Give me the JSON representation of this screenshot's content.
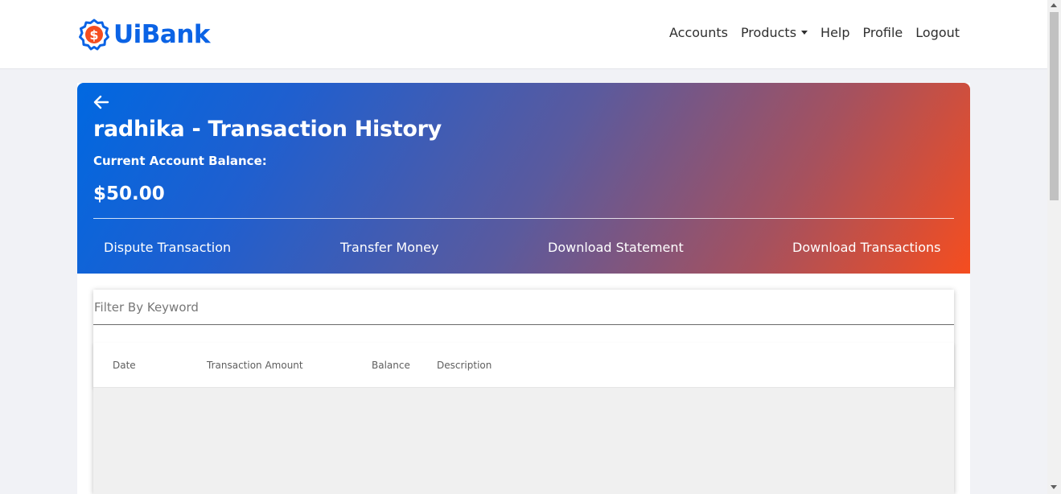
{
  "brand": {
    "name": "UiBank",
    "icon": "dollar-badge-icon",
    "color": "#0b63e5",
    "accent": "#f54d1f"
  },
  "nav": {
    "items": [
      {
        "label": "Accounts"
      },
      {
        "label": "Products",
        "has_dropdown": true
      },
      {
        "label": "Help"
      },
      {
        "label": "Profile"
      },
      {
        "label": "Logout"
      }
    ]
  },
  "hero": {
    "back_icon": "arrow-left-icon",
    "title": "radhika - Transaction History",
    "balance_label": "Current Account Balance:",
    "balance_value": "$50.00",
    "actions": [
      "Dispute Transaction",
      "Transfer Money",
      "Download Statement",
      "Download Transactions"
    ],
    "gradient_colors": [
      "#0068e1",
      "#f54d1f"
    ]
  },
  "filter": {
    "placeholder": "Filter By Keyword",
    "value": ""
  },
  "table": {
    "columns": [
      "Date",
      "Transaction Amount",
      "Balance",
      "Description"
    ],
    "rows": []
  }
}
